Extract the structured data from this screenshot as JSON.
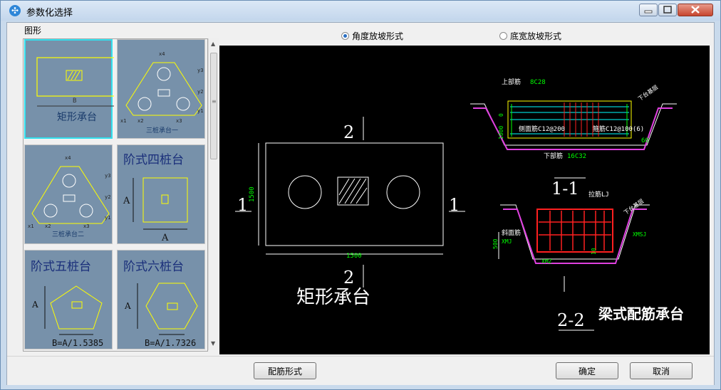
{
  "window": {
    "title": "参数化选择",
    "icon": "app-logo-icon"
  },
  "left_panel": {
    "group_label": "图形",
    "thumbnails": [
      {
        "label": "矩形承台",
        "dim_labels": [
          "B"
        ],
        "selected": true
      },
      {
        "label": "三桩承台一",
        "dim_labels": [
          "x4",
          "y3",
          "y2",
          "y1",
          "x1",
          "x2",
          "x3"
        ],
        "selected": false
      },
      {
        "label": "三桩承台二",
        "dim_labels": [
          "x4",
          "y3",
          "y2",
          "y1",
          "x1",
          "x2",
          "x3"
        ],
        "selected": false
      },
      {
        "label": "阶式四桩台",
        "dim_labels": [
          "A",
          "A"
        ],
        "selected": false
      },
      {
        "label": "阶式五桩台",
        "dim_labels": [
          "A",
          "B=A/1.5385"
        ],
        "selected": false
      },
      {
        "label": "阶式六桩台",
        "dim_labels": [
          "A",
          "B=A/1.7326"
        ],
        "selected": false
      }
    ]
  },
  "radio_options": [
    {
      "label": "角度放坡形式",
      "checked": true
    },
    {
      "label": "底宽放坡形式",
      "checked": false
    }
  ],
  "drawing": {
    "plan": {
      "caption": "矩形承台",
      "width_dim": "1500",
      "height_dim": "1500",
      "section_mark_1": "1",
      "section_mark_2": "2"
    },
    "section_1": {
      "title": "1-1",
      "labels": {
        "top_bar": "上部筋",
        "top_bar_spec": "8C28",
        "side_bar": "侧面筋C12@200",
        "stirrup": "箍筋C12@100(6)",
        "bottom_bar": "下部筋",
        "bottom_bar_spec": "16C32",
        "angle": "60",
        "fill": "下台基层",
        "left_dim_0": "0",
        "left_dim_1": "1000"
      }
    },
    "section_2": {
      "title": "2-2",
      "caption": "梁式配筋承台",
      "labels": {
        "tie": "拉筋LJ",
        "side": "斜面筋",
        "left_code": "XMJ",
        "right_code": "XMSJ",
        "bottom_code": "XMZ",
        "height_dim": "500",
        "dim_10": "10",
        "fill": "下台基层"
      }
    }
  },
  "buttons": {
    "rebar_form": "配筋形式",
    "ok": "确定",
    "cancel": "取消"
  },
  "colors": {
    "canvas_bg": "#000000",
    "thumb_bg": "#7791aa",
    "selection_border": "#33e0ee",
    "cad_yellow": "#ffff00",
    "cad_green": "#00ff00",
    "cad_red": "#ff2020",
    "cad_magenta": "#e040e0"
  }
}
